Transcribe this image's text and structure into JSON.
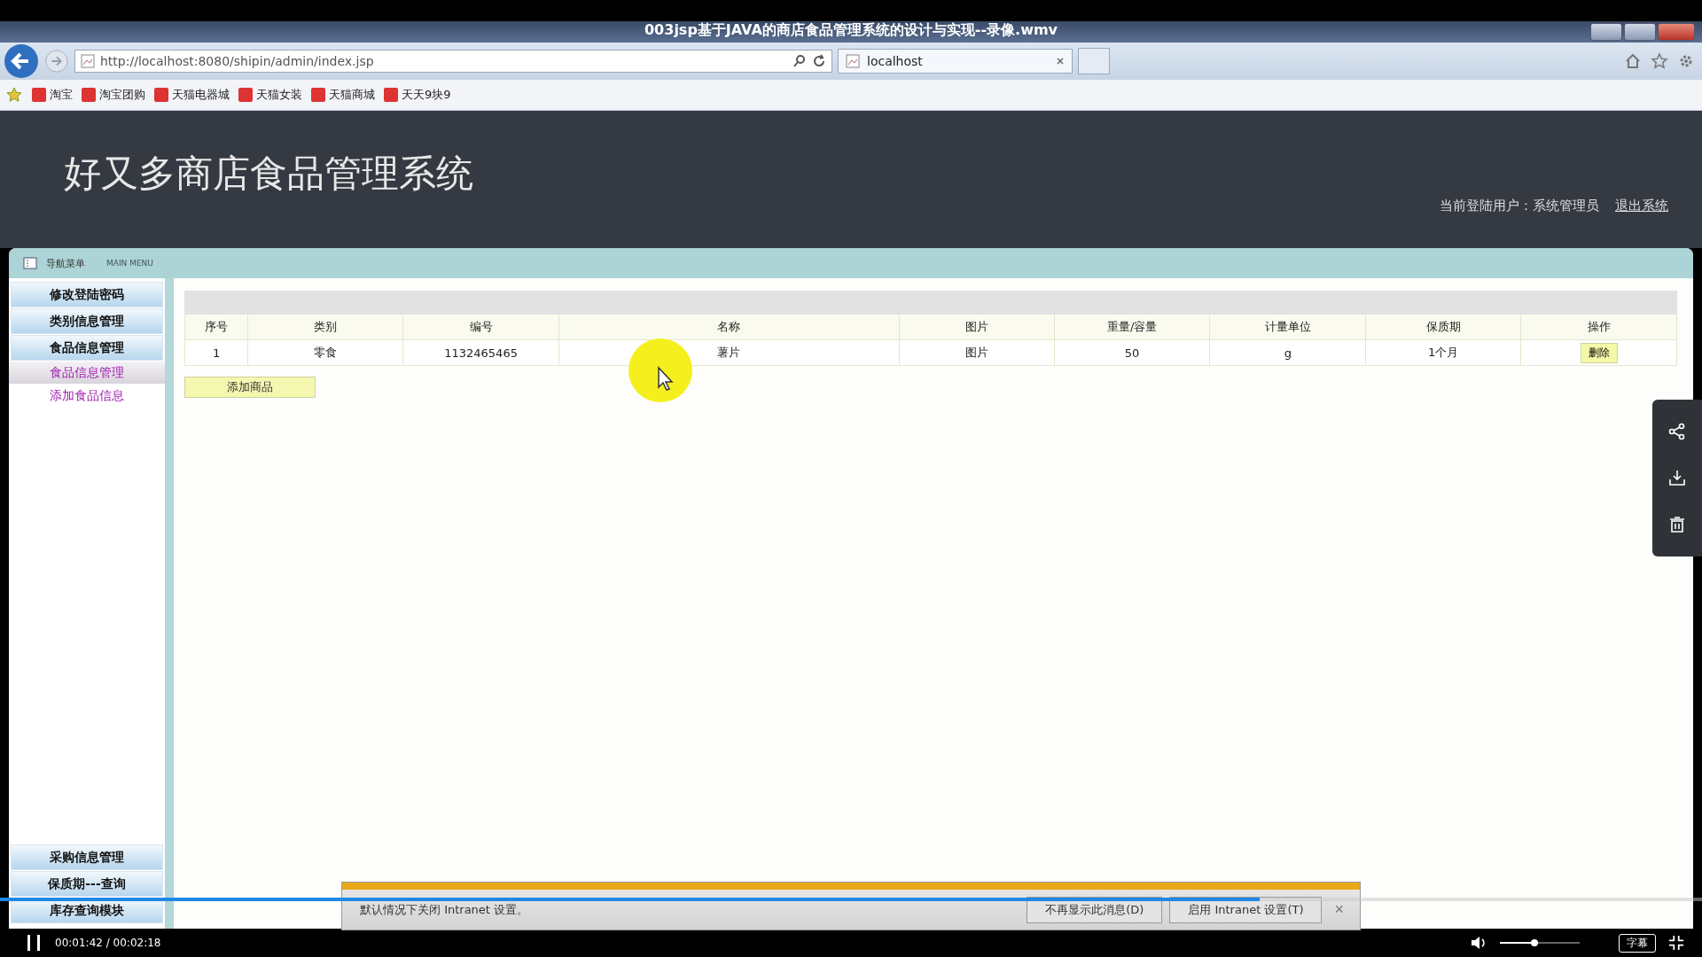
{
  "window": {
    "title": "003jsp基于JAVA的商店食品管理系统的设计与实现--录像.wmv"
  },
  "browser": {
    "url": "http://localhost:8080/shipin/admin/index.jsp",
    "tab": "localhost",
    "favorites": [
      "淘宝",
      "淘宝团购",
      "天猫电器城",
      "天猫女装",
      "天猫商城",
      "天天9块9"
    ]
  },
  "page": {
    "title": "好又多商店食品管理系统",
    "user_label": "当前登陆用户：系统管理员",
    "logout": "退出系统"
  },
  "menu_header": {
    "title": "导航菜单",
    "subtitle": "MAIN MENU"
  },
  "sidebar": {
    "top_items": [
      {
        "label": "修改登陆密码"
      },
      {
        "label": "类别信息管理"
      },
      {
        "label": "食品信息管理",
        "children": [
          {
            "label": "食品信息管理",
            "selected": true
          },
          {
            "label": "添加食品信息",
            "selected": false
          }
        ]
      }
    ],
    "bottom_items": [
      {
        "label": "采购信息管理"
      },
      {
        "label": "保质期---查询"
      },
      {
        "label": "库存查询模块"
      }
    ]
  },
  "table": {
    "columns": [
      "序号",
      "类别",
      "编号",
      "名称",
      "图片",
      "重量/容量",
      "计量单位",
      "保质期",
      "操作"
    ],
    "rows": [
      {
        "cells": [
          "1",
          "零食",
          "1132465465",
          "薯片",
          "图片",
          "50",
          "g",
          "1个月"
        ],
        "action": "删除"
      }
    ]
  },
  "add_button": "添加商品",
  "notification": {
    "text": "默认情况下关闭 Intranet 设置。",
    "buttons": [
      "不再显示此消息(D)",
      "启用 Intranet 设置(T)"
    ],
    "close": "×"
  },
  "player": {
    "playing": true,
    "time": "00:01:42 / 00:02:18",
    "progress": {
      "level": 0.74
    },
    "volume": {
      "level": 0.43
    },
    "subtitles": "字幕"
  }
}
